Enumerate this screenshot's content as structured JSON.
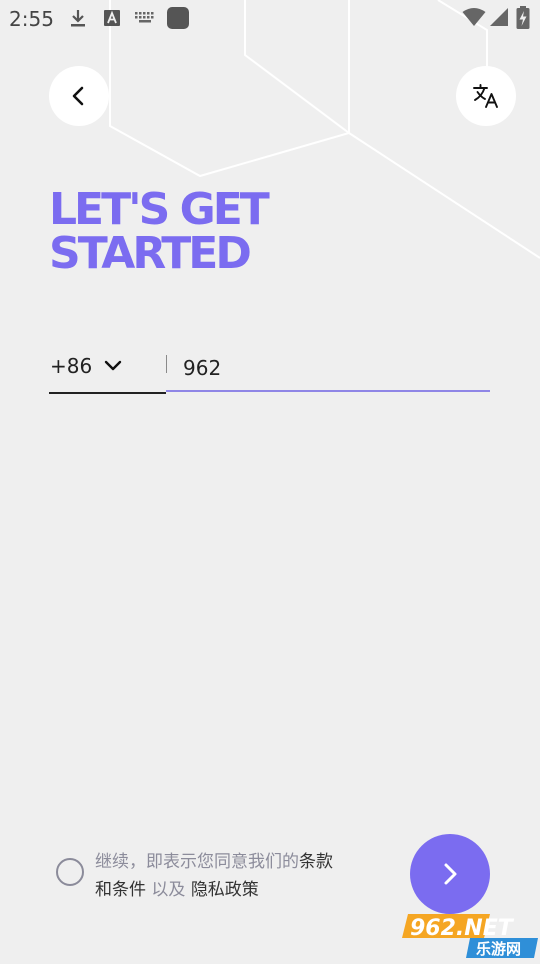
{
  "status_bar": {
    "time": "2:55",
    "left_icons": [
      "download-icon",
      "text-a-icon",
      "keyboard-icon",
      "app-square-icon"
    ],
    "right_icons": [
      "wifi-icon",
      "cell-signal-icon",
      "battery-charging-icon"
    ]
  },
  "header": {
    "back_icon": "chevron-left-icon",
    "translate_icon": "translate-icon"
  },
  "heading": {
    "line1": "LET'S GET",
    "line2": "STARTED"
  },
  "phone": {
    "country_code": "+86",
    "value": "962"
  },
  "agreement": {
    "prefix": "继续，即表示您同意我们的",
    "terms": "条款和条件",
    "conjunction": "以及",
    "privacy": "隐私政策"
  },
  "watermark": {
    "brand": "962.NET",
    "sub": "乐游网"
  },
  "colors": {
    "accent": "#7b6cf0",
    "background": "#efefef",
    "input_underline": "#8f86e6"
  }
}
